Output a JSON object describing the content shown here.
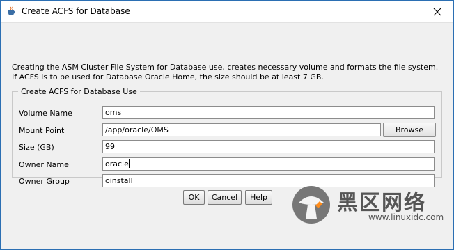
{
  "window": {
    "title": "Create ACFS for Database",
    "icons": {
      "app": "java-cup-icon",
      "close": "close-icon"
    }
  },
  "description": "Creating the ASM Cluster File System for Database use, creates necessary volume and formats the file system. If ACFS is to be used for Database Oracle Home, the size should be at least 7 GB.",
  "group": {
    "legend": "Create ACFS for Database Use",
    "fields": {
      "volume_name": {
        "label": "Volume Name",
        "value": "oms"
      },
      "mount_point": {
        "label": "Mount Point",
        "value": "/app/oracle/OMS"
      },
      "size": {
        "label": "Size (GB)",
        "value": "99"
      },
      "owner_name": {
        "label": "Owner Name",
        "value": "oracle"
      },
      "owner_group": {
        "label": "Owner Group",
        "value": "oinstall"
      }
    },
    "browse_label": "Browse"
  },
  "buttons": {
    "ok": "OK",
    "cancel": "Cancel",
    "help": "Help"
  },
  "watermark": {
    "text": "黑区网络",
    "url": "www.linuxidc.com",
    "icon": "mushroom-logo-icon"
  },
  "colors": {
    "window_border": "#2b6fb3",
    "dialog_bg": "#f0f0f0"
  }
}
